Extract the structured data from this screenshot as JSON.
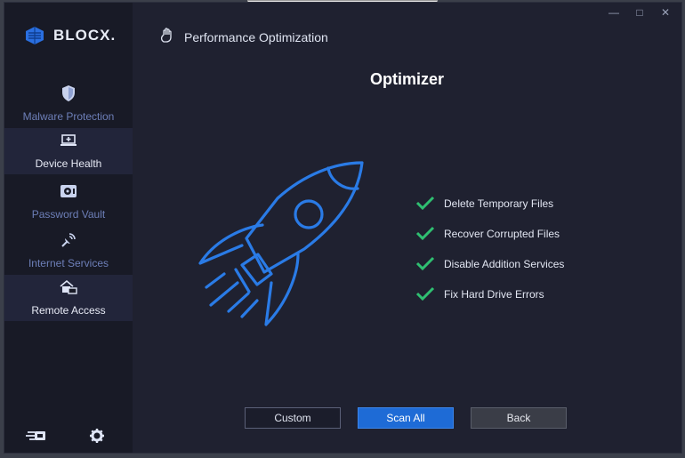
{
  "app": {
    "name": "BLOCX."
  },
  "header": {
    "title": "Performance Optimization"
  },
  "sidebar": {
    "items": [
      {
        "label": "Malware Protection",
        "icon": "shield-icon"
      },
      {
        "label": "Device Health",
        "icon": "laptop-plus-icon"
      },
      {
        "label": "Password Vault",
        "icon": "vault-icon"
      },
      {
        "label": "Internet Services",
        "icon": "satellite-icon"
      },
      {
        "label": "Remote Access",
        "icon": "remote-access-icon"
      }
    ]
  },
  "main": {
    "title": "Optimizer",
    "checklist": [
      "Delete Temporary Files",
      "Recover Corrupted Files",
      "Disable Addition Services",
      "Fix Hard Drive Errors"
    ]
  },
  "buttons": {
    "custom": "Custom",
    "scan_all": "Scan All",
    "back": "Back"
  },
  "debug_toolbar": {
    "count": "3"
  },
  "colors": {
    "accent": "#1e6bd6",
    "rocket": "#2a7be6",
    "check": "#2fbf71",
    "sidebar_bg": "#181a26",
    "main_bg": "#1f2130"
  }
}
